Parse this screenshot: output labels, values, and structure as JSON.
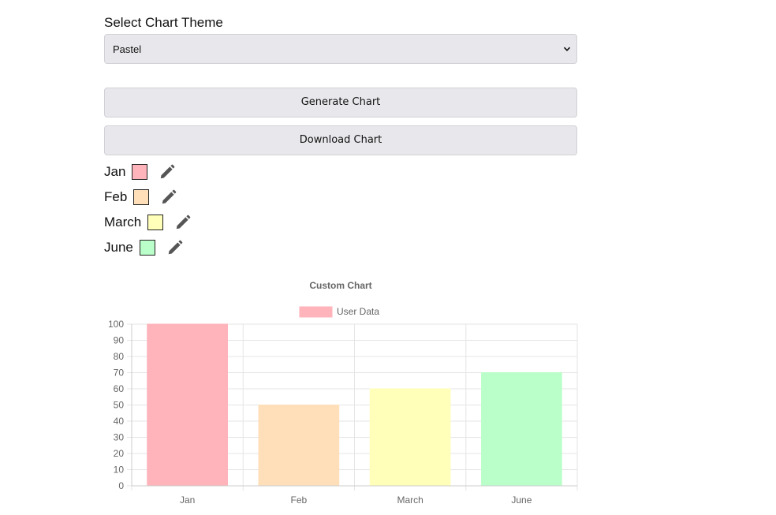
{
  "theme_selector": {
    "label": "Select Chart Theme",
    "selected": "Pastel"
  },
  "buttons": {
    "generate": "Generate Chart",
    "download": "Download Chart"
  },
  "data_items": [
    {
      "label": "Jan",
      "color": "#ffb3ba"
    },
    {
      "label": "Feb",
      "color": "#ffdfba"
    },
    {
      "label": "March",
      "color": "#ffffba"
    },
    {
      "label": "June",
      "color": "#baffc9"
    }
  ],
  "icons": {
    "edit": "pencil-icon",
    "dropdown": "chevron-down-icon"
  },
  "chart_data": {
    "type": "bar",
    "title": "Custom Chart",
    "categories": [
      "Jan",
      "Feb",
      "March",
      "June"
    ],
    "series": [
      {
        "name": "User Data",
        "values": [
          100,
          50,
          60,
          70
        ],
        "colors": [
          "#ffb3ba",
          "#ffdfba",
          "#ffffba",
          "#baffc9"
        ]
      }
    ],
    "ylim": [
      0,
      100
    ],
    "yticks": [
      0,
      10,
      20,
      30,
      40,
      50,
      60,
      70,
      80,
      90,
      100
    ],
    "legend_position": "top",
    "grid": true
  }
}
